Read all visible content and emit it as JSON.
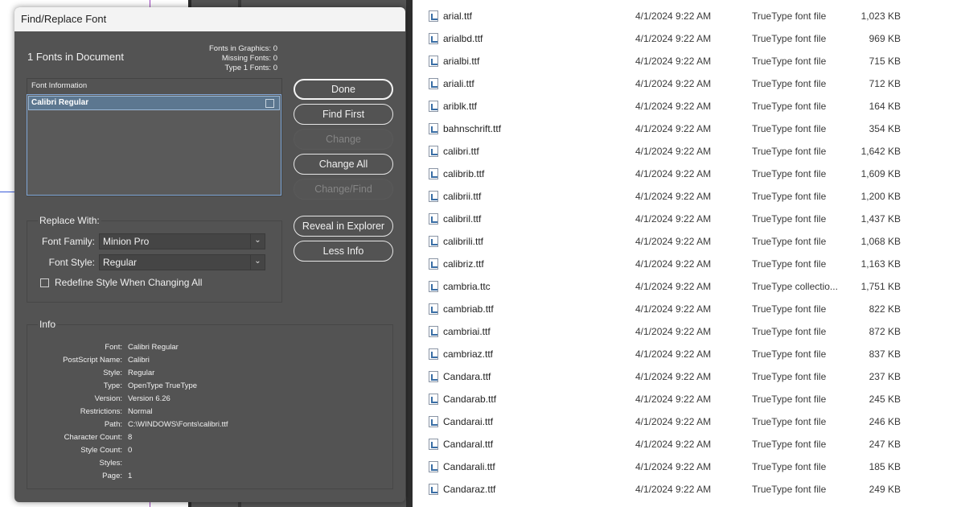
{
  "dialog": {
    "title": "Find/Replace Font",
    "fonts_in_document": "1 Fonts in Document",
    "stats": {
      "graphics": "Fonts in Graphics: 0",
      "missing": "Missing Fonts: 0",
      "type1": "Type 1 Fonts: 0"
    },
    "font_information_label": "Font Information",
    "font_list": [
      "Calibri Regular"
    ],
    "buttons": {
      "done": "Done",
      "find_first": "Find First",
      "change": "Change",
      "change_all": "Change All",
      "change_find": "Change/Find",
      "reveal": "Reveal in Explorer",
      "less_info": "Less Info"
    },
    "replace_with": {
      "title": "Replace With:",
      "family_label": "Font Family:",
      "family_value": "Minion Pro",
      "style_label": "Font Style:",
      "style_value": "Regular",
      "redefine_label": "Redefine Style When Changing All",
      "redefine_checked": false
    },
    "info": {
      "title": "Info",
      "rows": [
        {
          "key": "Font:",
          "value": "Calibri Regular"
        },
        {
          "key": "PostScript Name:",
          "value": "Calibri"
        },
        {
          "key": "Style:",
          "value": "Regular"
        },
        {
          "key": "Type:",
          "value": "OpenType TrueType"
        },
        {
          "key": "Version:",
          "value": "Version 6.26"
        },
        {
          "key": "Restrictions:",
          "value": "Normal"
        },
        {
          "key": "Path:",
          "value": "C:\\WINDOWS\\Fonts\\calibri.ttf"
        },
        {
          "key": "Character Count:",
          "value": "8"
        },
        {
          "key": "Style Count:",
          "value": "0"
        },
        {
          "key": "Styles:",
          "value": ""
        },
        {
          "key": "Page:",
          "value": "1"
        }
      ]
    }
  },
  "explorer": {
    "files": [
      {
        "name": "arial.ttf",
        "date": "4/1/2024 9:22 AM",
        "type": "TrueType font file",
        "size": "1,023 KB"
      },
      {
        "name": "arialbd.ttf",
        "date": "4/1/2024 9:22 AM",
        "type": "TrueType font file",
        "size": "969 KB"
      },
      {
        "name": "arialbi.ttf",
        "date": "4/1/2024 9:22 AM",
        "type": "TrueType font file",
        "size": "715 KB"
      },
      {
        "name": "ariali.ttf",
        "date": "4/1/2024 9:22 AM",
        "type": "TrueType font file",
        "size": "712 KB"
      },
      {
        "name": "ariblk.ttf",
        "date": "4/1/2024 9:22 AM",
        "type": "TrueType font file",
        "size": "164 KB"
      },
      {
        "name": "bahnschrift.ttf",
        "date": "4/1/2024 9:22 AM",
        "type": "TrueType font file",
        "size": "354 KB"
      },
      {
        "name": "calibri.ttf",
        "date": "4/1/2024 9:22 AM",
        "type": "TrueType font file",
        "size": "1,642 KB"
      },
      {
        "name": "calibrib.ttf",
        "date": "4/1/2024 9:22 AM",
        "type": "TrueType font file",
        "size": "1,609 KB"
      },
      {
        "name": "calibrii.ttf",
        "date": "4/1/2024 9:22 AM",
        "type": "TrueType font file",
        "size": "1,200 KB"
      },
      {
        "name": "calibril.ttf",
        "date": "4/1/2024 9:22 AM",
        "type": "TrueType font file",
        "size": "1,437 KB"
      },
      {
        "name": "calibrili.ttf",
        "date": "4/1/2024 9:22 AM",
        "type": "TrueType font file",
        "size": "1,068 KB"
      },
      {
        "name": "calibriz.ttf",
        "date": "4/1/2024 9:22 AM",
        "type": "TrueType font file",
        "size": "1,163 KB"
      },
      {
        "name": "cambria.ttc",
        "date": "4/1/2024 9:22 AM",
        "type": "TrueType collectio...",
        "size": "1,751 KB"
      },
      {
        "name": "cambriab.ttf",
        "date": "4/1/2024 9:22 AM",
        "type": "TrueType font file",
        "size": "822 KB"
      },
      {
        "name": "cambriai.ttf",
        "date": "4/1/2024 9:22 AM",
        "type": "TrueType font file",
        "size": "872 KB"
      },
      {
        "name": "cambriaz.ttf",
        "date": "4/1/2024 9:22 AM",
        "type": "TrueType font file",
        "size": "837 KB"
      },
      {
        "name": "Candara.ttf",
        "date": "4/1/2024 9:22 AM",
        "type": "TrueType font file",
        "size": "237 KB"
      },
      {
        "name": "Candarab.ttf",
        "date": "4/1/2024 9:22 AM",
        "type": "TrueType font file",
        "size": "245 KB"
      },
      {
        "name": "Candarai.ttf",
        "date": "4/1/2024 9:22 AM",
        "type": "TrueType font file",
        "size": "246 KB"
      },
      {
        "name": "Candaral.ttf",
        "date": "4/1/2024 9:22 AM",
        "type": "TrueType font file",
        "size": "247 KB"
      },
      {
        "name": "Candarali.ttf",
        "date": "4/1/2024 9:22 AM",
        "type": "TrueType font file",
        "size": "185 KB"
      },
      {
        "name": "Candaraz.ttf",
        "date": "4/1/2024 9:22 AM",
        "type": "TrueType font file",
        "size": "249 KB"
      }
    ]
  }
}
